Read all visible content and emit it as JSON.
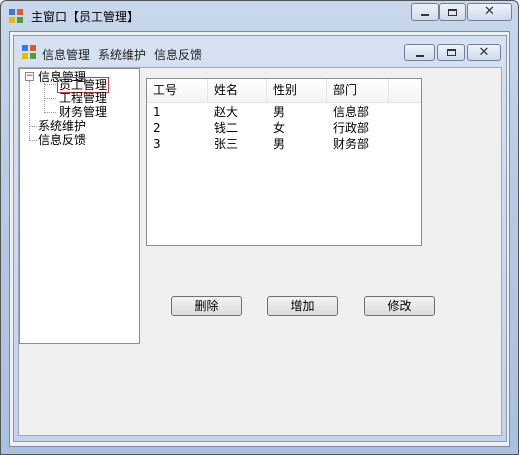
{
  "outer_window": {
    "title": "主窗口【员工管理】",
    "buttons": {
      "minimize": "minimize",
      "maximize": "maximize",
      "close": "close"
    }
  },
  "inner_window": {
    "menu": [
      {
        "label": "信息管理"
      },
      {
        "label": "系统维护"
      },
      {
        "label": "信息反馈"
      }
    ],
    "buttons": {
      "minimize": "minimize",
      "maximize": "maximize",
      "close": "close"
    }
  },
  "tree": {
    "root": {
      "label": "信息管理",
      "expander": "⊟"
    },
    "children": [
      {
        "label": "员工管理",
        "selected": true
      },
      {
        "label": "工程管理"
      },
      {
        "label": "财务管理"
      }
    ],
    "others": [
      {
        "label": "系统维护"
      },
      {
        "label": "信息反馈"
      }
    ]
  },
  "table": {
    "columns": [
      "工号",
      "姓名",
      "性别",
      "部门"
    ],
    "rows": [
      [
        "1",
        "赵大",
        "男",
        "信息部"
      ],
      [
        "2",
        "钱二",
        "女",
        "行政部"
      ],
      [
        "3",
        "张三",
        "男",
        "财务部"
      ]
    ]
  },
  "actions": {
    "delete": "删除",
    "add": "增加",
    "edit": "修改"
  },
  "icons": {
    "app": "app-icon",
    "close": "close-icon"
  },
  "colors": {
    "selection_border": "#d23c3c",
    "title_bg": "#b7cbe6"
  }
}
